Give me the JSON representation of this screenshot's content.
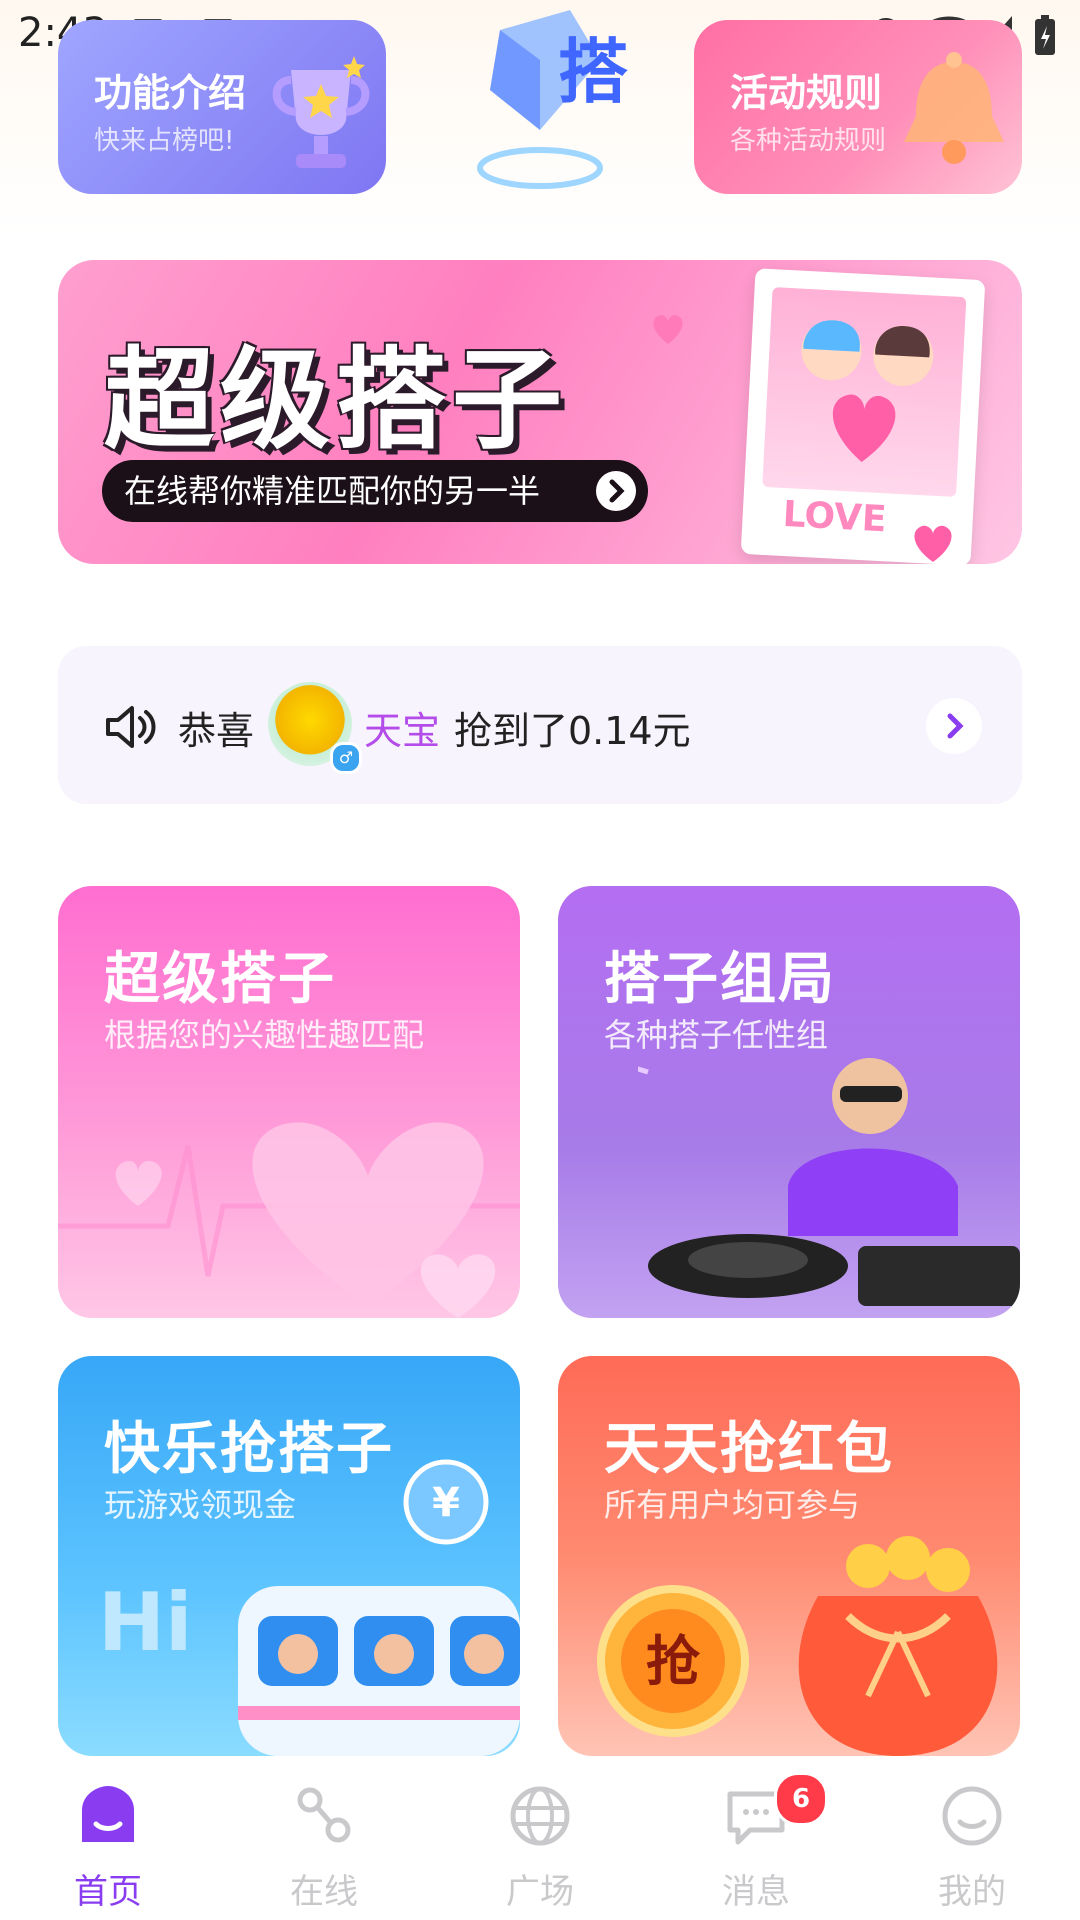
{
  "status": {
    "time": "2:43"
  },
  "top_cards": {
    "features": {
      "title": "功能介绍",
      "subtitle": "快来占榜吧!"
    },
    "rules": {
      "title": "活动规则",
      "subtitle": "各种活动规则"
    }
  },
  "logo": {
    "glyph": "搭"
  },
  "banner": {
    "title": "超级搭子",
    "tagline": "在线帮你精准匹配你的另一半",
    "photo_caption": "LOVE"
  },
  "notice": {
    "prefix": "恭喜",
    "username": "天宝",
    "message": "抢到了0.14元",
    "gender_symbol": "♂"
  },
  "tiles": [
    {
      "title": "超级搭子",
      "subtitle": "根据您的兴趣性趣匹配"
    },
    {
      "title": "搭子组局",
      "subtitle": "各种搭子任性组"
    },
    {
      "title": "快乐抢搭子",
      "subtitle": "玩游戏领现金"
    },
    {
      "title": "天天抢红包",
      "subtitle": "所有用户均可参与"
    }
  ],
  "tile_decor": {
    "hi": "Hi",
    "grab": "抢",
    "coin": "¥"
  },
  "tabbar": {
    "tabs": [
      {
        "label": "首页",
        "icon": "home-icon",
        "active": true
      },
      {
        "label": "在线",
        "icon": "online-icon",
        "active": false
      },
      {
        "label": "广场",
        "icon": "globe-icon",
        "active": false
      },
      {
        "label": "消息",
        "icon": "message-icon",
        "active": false,
        "badge": "6"
      },
      {
        "label": "我的",
        "icon": "profile-icon",
        "active": false
      }
    ]
  },
  "colors": {
    "accent": "#8a3df0",
    "username": "#b34ce8",
    "badge": "#ff3b4a"
  }
}
